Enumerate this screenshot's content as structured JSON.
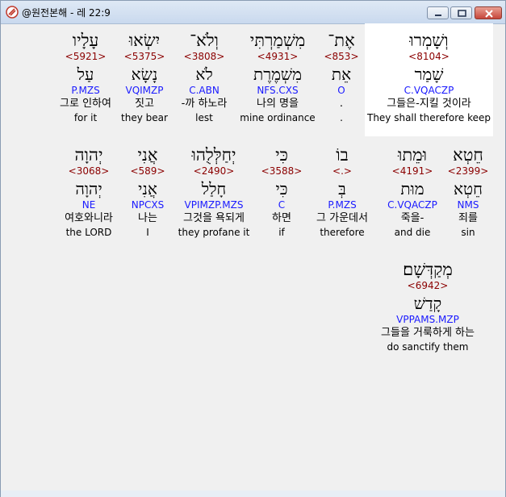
{
  "window": {
    "title": "@원전본해 - 레 22:9",
    "buttons": {
      "minimize": "minimize",
      "maximize": "maximize",
      "close": "close"
    }
  },
  "rows": [
    {
      "words": [
        {
          "heb": "עָלָיו",
          "strong": "<5921>",
          "lemma": "עַל",
          "morph": "P.MZS",
          "kor": "그로 인하여",
          "eng": "for it"
        },
        {
          "heb": "יִשְׂאוּ",
          "strong": "<5375>",
          "lemma": "נָשָׂא",
          "morph": "VQIMZP",
          "kor": "짓고",
          "eng": "they bear"
        },
        {
          "heb": "וְלֹא־",
          "strong": "<3808>",
          "lemma": "לֹא",
          "morph": "C.ABN",
          "kor": "-까 하노라",
          "eng": "lest"
        },
        {
          "heb": "מִשְׁמַרְתִּי",
          "strong": "<4931>",
          "lemma": "מִשְׁמֶרֶת",
          "morph": "NFS.CXS",
          "kor": "나의 명을",
          "eng": "mine ordinance"
        },
        {
          "heb": "אֶת־",
          "strong": "<853>",
          "lemma": "אֵת",
          "morph": "O",
          "kor": ".",
          "eng": "."
        },
        {
          "heb": "וְשָׁמְרוּ",
          "strong": "<8104>",
          "lemma": "שָׁמַר",
          "morph": "C.VQACZP",
          "kor": "그들은-지킬 것이라",
          "eng": "They shall therefore keep"
        }
      ]
    },
    {
      "words": [
        {
          "heb": "יְהוָה",
          "strong": "<3068>",
          "lemma": "יְהוָה",
          "morph": "NE",
          "kor": "여호와니라",
          "eng": "the LORD"
        },
        {
          "heb": "אֲנִי",
          "strong": "<589>",
          "lemma": "אֲנִי",
          "morph": "NPCXS",
          "kor": "나는",
          "eng": "I"
        },
        {
          "heb": "יְחַלְּלֻהוּ",
          "strong": "<2490>",
          "lemma": "חָלַל",
          "morph": "VPIMZP.MZS",
          "kor": "그것을 욕되게",
          "eng": "they profane it"
        },
        {
          "heb": "כִּי",
          "strong": "<3588>",
          "lemma": "כִּי",
          "morph": "C",
          "kor": "하면",
          "eng": "if"
        },
        {
          "heb": "בוֹ",
          "strong": "<.>",
          "lemma": "בְּ",
          "morph": "P.MZS",
          "kor": "그 가운데서",
          "eng": "therefore"
        },
        {
          "heb": "וּמֵתוּ",
          "strong": "<4191>",
          "lemma": "מוּת",
          "morph": "C.VQACZP",
          "kor": "죽을-",
          "eng": "and die"
        },
        {
          "heb": "חֵטְא",
          "strong": "<2399>",
          "lemma": "חֵטְא",
          "morph": "NMS",
          "kor": "죄를",
          "eng": "sin"
        }
      ]
    },
    {
      "words": [
        {
          "heb": "מְקַדְּשָׁם׃",
          "strong": "<6942>",
          "lemma": "קָדַשׁ",
          "morph": "VPPAMS.MZP",
          "kor": "그들을 거룩하게 하는",
          "eng": "do sanctify them"
        }
      ]
    }
  ]
}
